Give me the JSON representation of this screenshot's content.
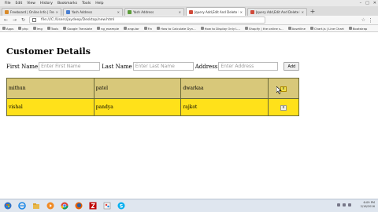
{
  "browser": {
    "menu": [
      "File",
      "Edit",
      "View",
      "History",
      "Bookmarks",
      "Tools",
      "Help"
    ],
    "tabs": [
      {
        "label": "Freeboard | Online Info | Free |",
        "active": false,
        "color": "#d98b2b"
      },
      {
        "label": "Yash Address",
        "active": false,
        "color": "#4a7fd1"
      },
      {
        "label": "Yash Address",
        "active": false,
        "color": "#5c9c3a"
      },
      {
        "label": "Jquery Add,Edit And Delete Row",
        "active": true,
        "color": "#d04a3a"
      },
      {
        "label": "Jquery Add,Edit And Delete Row",
        "active": false,
        "color": "#d04a3a"
      }
    ],
    "url": "file:///C:/Users/jaydeep/Desktop/new.html",
    "bookmarks": [
      "Apps",
      "php",
      "Img",
      "Tools",
      "Google Translate",
      "ng_example",
      "angular",
      "Fin",
      "How to Calculate Dyn...",
      "How to Display Only L...",
      "Shopify | the online s...",
      "Assetline",
      "Chart.js | Line Chart",
      "Bootstrap"
    ]
  },
  "page": {
    "title": "Customer Details",
    "form": {
      "first_label": "First Name",
      "first_placeholder": "Enter First Name",
      "last_label": "Last Name",
      "last_placeholder": "Enter Last Name",
      "address_label": "Address",
      "address_placeholder": "Enter Address",
      "add_button": "Add"
    },
    "rows": [
      {
        "first": "mithun",
        "last": "patel",
        "address": "dwarkaa",
        "delete": "x"
      },
      {
        "first": "vishal",
        "last": "pandya",
        "address": "rajkot",
        "delete": "x"
      }
    ],
    "row_colors": [
      "#d8c87a",
      "#ffe11a"
    ]
  },
  "taskbar": {
    "apps": [
      "start",
      "ie",
      "explorer",
      "media",
      "chrome",
      "firefox",
      "filezilla",
      "paint",
      "skype"
    ],
    "time": "6:09 PM",
    "date": "2/18/2016"
  }
}
